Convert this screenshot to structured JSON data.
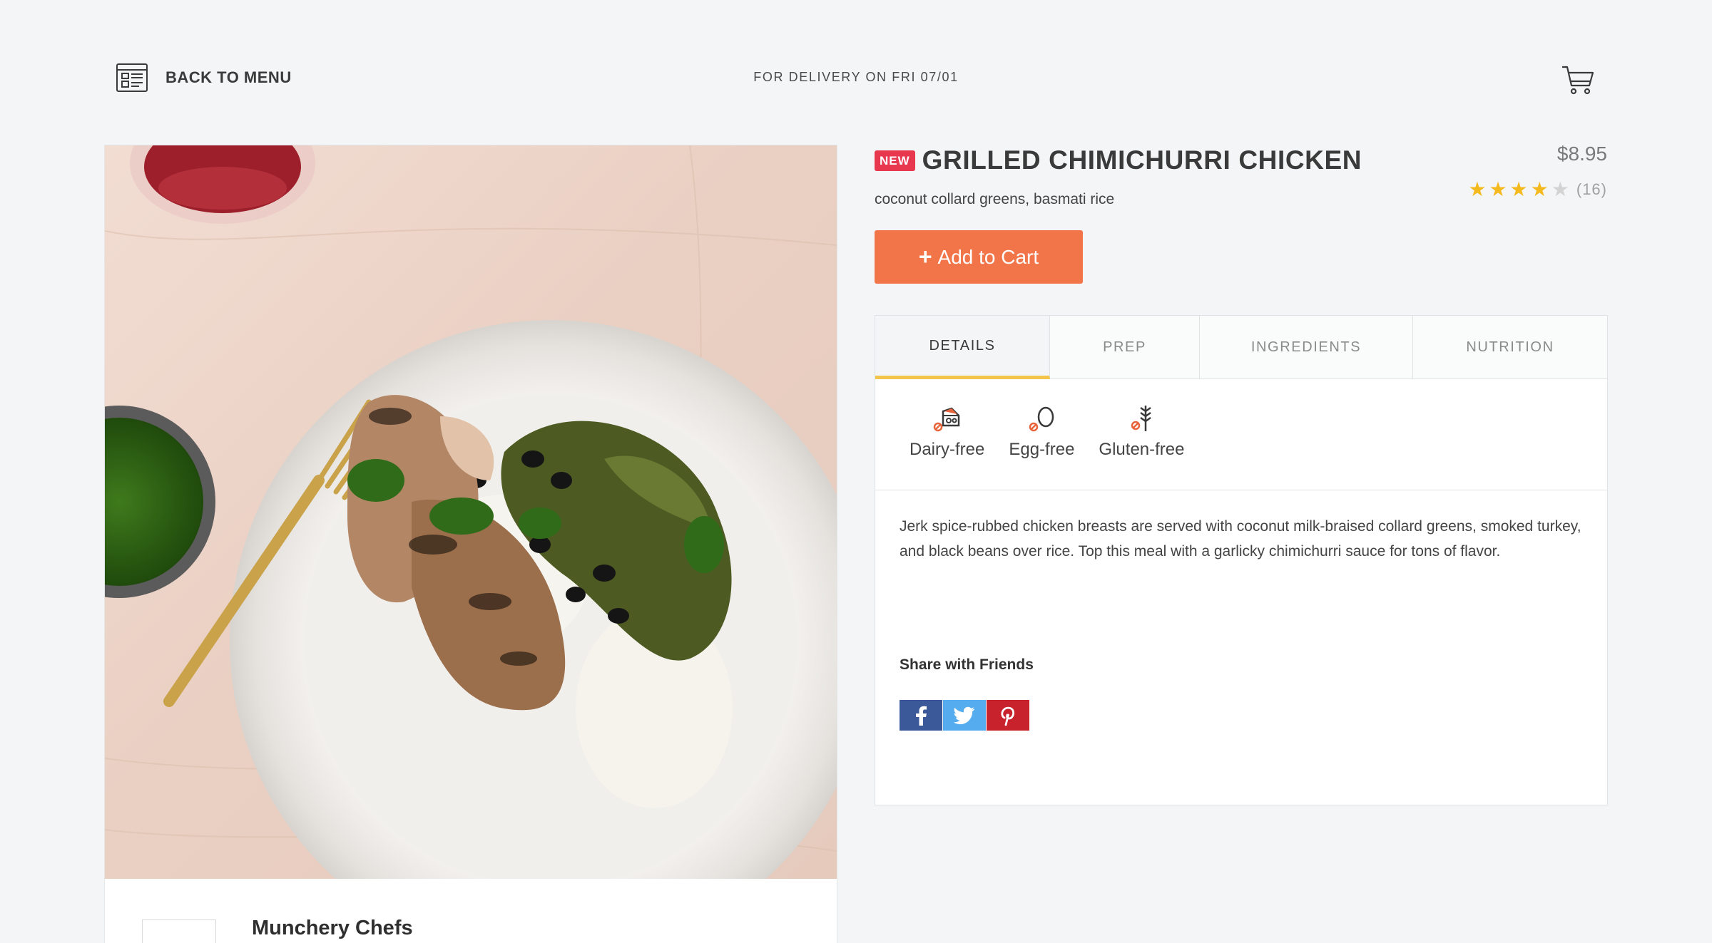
{
  "header": {
    "back_label": "BACK TO MENU",
    "delivery_text": "FOR DELIVERY ON FRI 07/01",
    "icons": {
      "back": "menu-card-icon",
      "cart": "cart-icon"
    }
  },
  "product": {
    "badge": "NEW",
    "title": "GRILLED CHIMICHURRI CHICKEN",
    "price": "$8.95",
    "rating": {
      "value": 4,
      "max": 5,
      "count": "(16)"
    },
    "subtitle": "coconut collard greens, basmati rice",
    "add_to_cart": "Add to Cart"
  },
  "tabs": [
    {
      "label": "DETAILS",
      "active": true
    },
    {
      "label": "PREP",
      "active": false
    },
    {
      "label": "INGREDIENTS",
      "active": false
    },
    {
      "label": "NUTRITION",
      "active": false
    }
  ],
  "diets": [
    {
      "label": "Dairy-free",
      "icon": "dairy-free-icon"
    },
    {
      "label": "Egg-free",
      "icon": "egg-free-icon"
    },
    {
      "label": "Gluten-free",
      "icon": "gluten-free-icon"
    }
  ],
  "description": "Jerk spice-rubbed chicken breasts are served with coconut milk-braised collard greens, smoked turkey, and black beans over rice. Top this meal with a garlicky chimichurri sauce for tons of flavor.",
  "share": {
    "title": "Share with Friends",
    "buttons": [
      {
        "label": "f",
        "icon": "facebook-icon"
      },
      {
        "label": "t",
        "icon": "twitter-icon"
      },
      {
        "label": "p",
        "icon": "pinterest-icon"
      }
    ]
  },
  "chef": {
    "name": "Munchery Chefs"
  },
  "colors": {
    "accent": "#f2754a",
    "badge": "#e8384f",
    "star": "#f4b91d",
    "tab_underline": "#f3c54a",
    "facebook": "#3b5998",
    "twitter": "#55acee",
    "pinterest": "#c8232c"
  }
}
